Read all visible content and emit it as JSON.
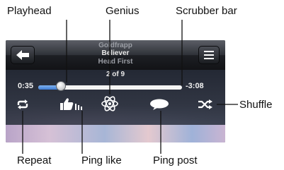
{
  "callouts": {
    "playhead": "Playhead",
    "genius": "Genius",
    "scrubber_bar": "Scrubber bar",
    "shuffle": "Shuffle",
    "repeat": "Repeat",
    "ping_like": "Ping like",
    "ping_post": "Ping post"
  },
  "now_playing": {
    "artist": "Goldfrapp",
    "song": "Believer",
    "album": "Head First"
  },
  "track_position": "2 of 9",
  "time": {
    "elapsed": "0:35",
    "remaining": "-3:08"
  },
  "playback_progress": 0.16,
  "colors": {
    "accent_blue": "#3d7bd4",
    "bar_dark": "#121316"
  },
  "icons": [
    "back-arrow-icon",
    "track-list-icon",
    "repeat-icon",
    "ping-like-icon",
    "genius-icon",
    "ping-post-icon",
    "shuffle-icon"
  ]
}
